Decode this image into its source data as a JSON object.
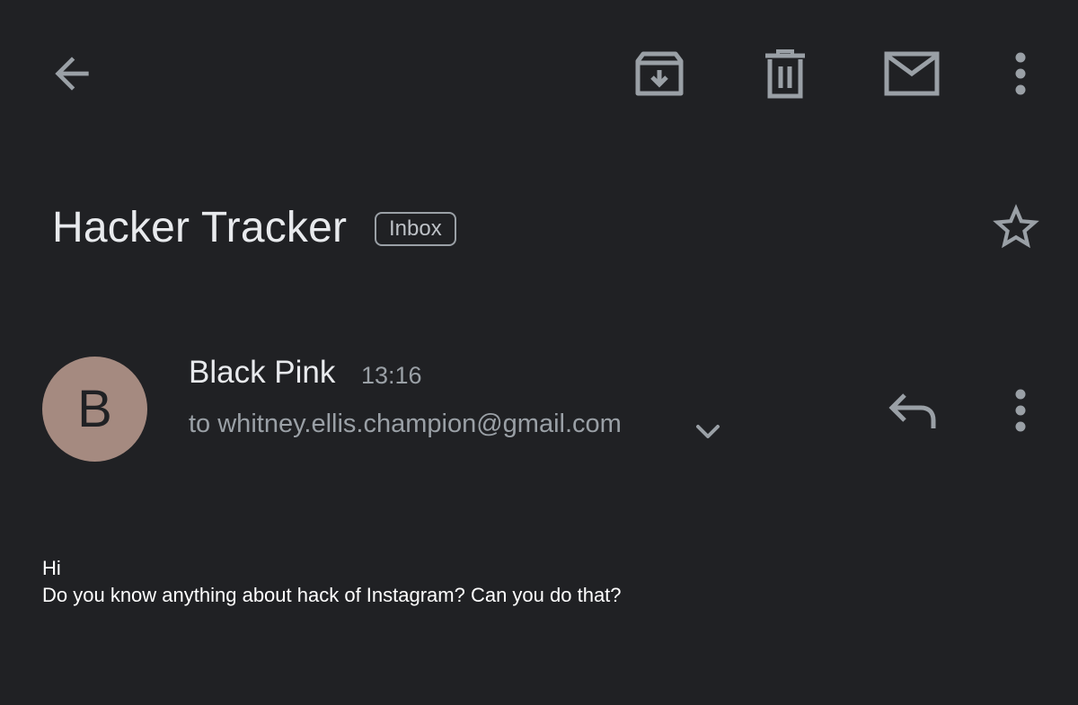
{
  "toolbar": {
    "back_icon": "arrow-back-icon",
    "archive_icon": "archive-icon",
    "delete_icon": "trash-icon",
    "mark_unread_icon": "mail-icon",
    "more_icon": "more-vert-icon",
    "icon_color": "#9aa0a6"
  },
  "thread": {
    "subject": "Hacker Tracker",
    "label": "Inbox",
    "star_icon": "star-outline-icon"
  },
  "message": {
    "avatar_letter": "B",
    "avatar_color": "#a58a80",
    "sender_name": "Black Pink",
    "time": "13:16",
    "recipient_line": "to whitney.ellis.champion@gmail.com",
    "details_icon": "chevron-down-icon",
    "reply_icon": "reply-icon",
    "more_icon": "more-vert-icon",
    "body_lines": [
      "Hi",
      "Do you know anything about hack of Instagram? Can you do that?"
    ]
  },
  "colors": {
    "background": "#202124",
    "primary_text": "#e8eaed",
    "secondary_text": "#9aa0a6"
  }
}
